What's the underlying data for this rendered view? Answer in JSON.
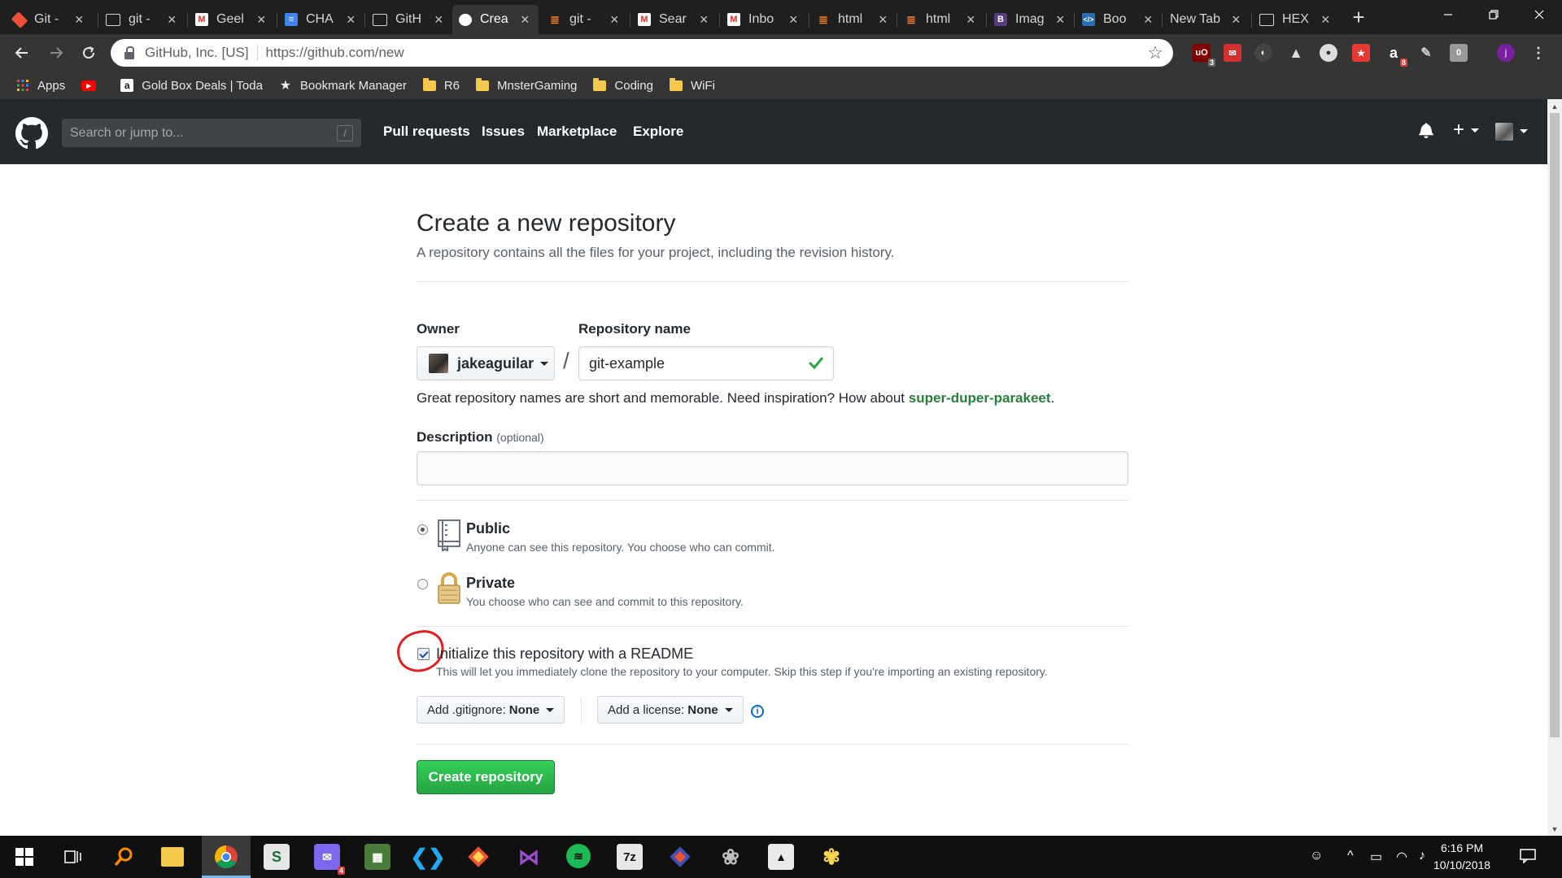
{
  "browser": {
    "tabs": [
      {
        "title": "Git -",
        "favicon": "git-icon"
      },
      {
        "title": "git -",
        "favicon": "document-icon"
      },
      {
        "title": "Geel",
        "favicon": "gmail-icon"
      },
      {
        "title": "CHA",
        "favicon": "google-docs-icon"
      },
      {
        "title": "GitH",
        "favicon": "document-icon"
      },
      {
        "title": "Crea",
        "favicon": "github-icon",
        "active": true
      },
      {
        "title": "git -",
        "favicon": "stackoverflow-icon"
      },
      {
        "title": "Sear",
        "favicon": "gmail-icon"
      },
      {
        "title": "Inbo",
        "favicon": "gmail-icon"
      },
      {
        "title": "html",
        "favicon": "stackoverflow-icon"
      },
      {
        "title": "html",
        "favicon": "stackoverflow-icon"
      },
      {
        "title": "Imag",
        "favicon": "bootstrap-icon"
      },
      {
        "title": "Boo",
        "favicon": "code-icon"
      },
      {
        "title": "New Tab",
        "favicon": ""
      },
      {
        "title": "HEX",
        "favicon": "document-icon"
      }
    ],
    "new_tab_label": "+",
    "omnibox": {
      "site_identity": "GitHub, Inc. [US]",
      "url": "https://github.com/new"
    },
    "extension_badges": {
      "ublock": "3",
      "amazon": "8"
    },
    "profile_initial": "j",
    "bookmarks": [
      {
        "label": "Apps",
        "icon": "apps-grid-icon"
      },
      {
        "label": "",
        "icon": "youtube-icon"
      },
      {
        "label": "Gold Box Deals | Toda",
        "icon": "amazon-icon"
      },
      {
        "label": "Bookmark Manager",
        "icon": "star-icon"
      },
      {
        "label": "R6",
        "icon": "folder-icon"
      },
      {
        "label": "MnsterGaming",
        "icon": "folder-icon"
      },
      {
        "label": "Coding",
        "icon": "folder-icon"
      },
      {
        "label": "WiFi",
        "icon": "folder-icon"
      }
    ]
  },
  "github_header": {
    "search_placeholder": "Search or jump to...",
    "search_shortcut": "/",
    "nav": [
      "Pull requests",
      "Issues",
      "Marketplace",
      "Explore"
    ]
  },
  "form": {
    "title": "Create a new repository",
    "subtitle": "A repository contains all the files for your project, including the revision history.",
    "owner_label": "Owner",
    "owner_value": "jakeaguilar",
    "separator": "/",
    "repo_name_label": "Repository name",
    "repo_name_value": "git-example",
    "hint_prefix": "Great repository names are short and memorable. Need inspiration? How about",
    "hint_suggestion": "super-duper-parakeet",
    "hint_suffix": ".",
    "description_label": "Description",
    "description_optional": "(optional)",
    "description_value": "",
    "visibility": [
      {
        "title": "Public",
        "desc": "Anyone can see this repository. You choose who can commit.",
        "checked": true,
        "icon": "repo-book-icon"
      },
      {
        "title": "Private",
        "desc": "You choose who can see and commit to this repository.",
        "checked": false,
        "icon": "lock-icon"
      }
    ],
    "readme_label": "Initialize this repository with a README",
    "readme_desc": "This will let you immediately clone the repository to your computer. Skip this step if you're importing an existing repository.",
    "readme_checked": true,
    "gitignore_label": "Add .gitignore:",
    "gitignore_value": "None",
    "license_label": "Add a license:",
    "license_value": "None",
    "submit_label": "Create repository"
  },
  "taskbar": {
    "time": "6:16 PM",
    "date": "10/10/2018",
    "messenger_badge": "4"
  },
  "colors": {
    "github_header": "#24292e",
    "primary_green": "#28a745",
    "suggestion_green": "#2a7e3b",
    "annotation_red": "#e02020",
    "browser_chrome": "#353535"
  }
}
